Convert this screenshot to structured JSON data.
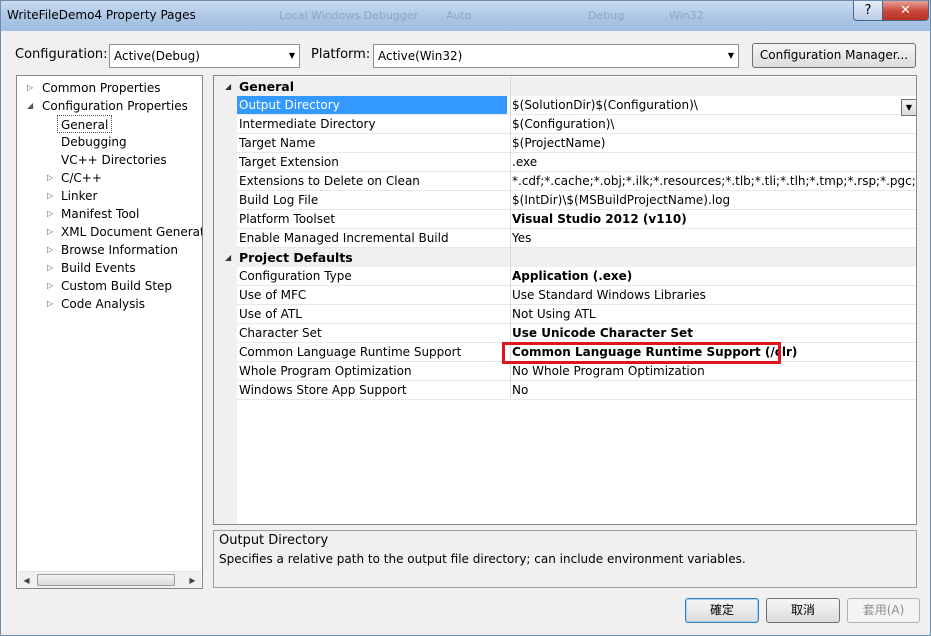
{
  "window": {
    "title": "WriteFileDemo4 Property Pages",
    "background_title_text": [
      "Local Windows Debugger",
      "Auto",
      "Debug",
      "Win32"
    ],
    "help_button": "?",
    "close_button": "✕"
  },
  "toolbar": {
    "configuration_label": "Configuration:",
    "configuration_value": "Active(Debug)",
    "platform_label": "Platform:",
    "platform_value": "Active(Win32)",
    "config_manager_button": "Configuration Manager..."
  },
  "tree": {
    "items": [
      {
        "label": "Common Properties",
        "expander": "▷"
      },
      {
        "label": "Configuration Properties",
        "expander": "◢"
      },
      {
        "label": "General",
        "expander": "",
        "selected": true
      },
      {
        "label": "Debugging",
        "expander": ""
      },
      {
        "label": "VC++ Directories",
        "expander": ""
      },
      {
        "label": "C/C++",
        "expander": "▷"
      },
      {
        "label": "Linker",
        "expander": "▷"
      },
      {
        "label": "Manifest Tool",
        "expander": "▷"
      },
      {
        "label": "XML Document Generator",
        "expander": "▷"
      },
      {
        "label": "Browse Information",
        "expander": "▷"
      },
      {
        "label": "Build Events",
        "expander": "▷"
      },
      {
        "label": "Custom Build Step",
        "expander": "▷"
      },
      {
        "label": "Code Analysis",
        "expander": "▷"
      }
    ]
  },
  "grid": {
    "categories": [
      {
        "name": "General",
        "expander": "◢",
        "rows": [
          {
            "name": "Output Directory",
            "value": "$(SolutionDir)$(Configuration)\\",
            "bold": false,
            "selected": true
          },
          {
            "name": "Intermediate Directory",
            "value": "$(Configuration)\\",
            "bold": false
          },
          {
            "name": "Target Name",
            "value": "$(ProjectName)",
            "bold": false
          },
          {
            "name": "Target Extension",
            "value": ".exe",
            "bold": false
          },
          {
            "name": "Extensions to Delete on Clean",
            "value": "*.cdf;*.cache;*.obj;*.ilk;*.resources;*.tlb;*.tli;*.tlh;*.tmp;*.rsp;*.pgc;*.pgd;*.meta;*.tlog;*.manifest;*.res",
            "bold": false
          },
          {
            "name": "Build Log File",
            "value": "$(IntDir)\\$(MSBuildProjectName).log",
            "bold": false
          },
          {
            "name": "Platform Toolset",
            "value": "Visual Studio 2012 (v110)",
            "bold": true
          },
          {
            "name": "Enable Managed Incremental Build",
            "value": "Yes",
            "bold": false
          }
        ]
      },
      {
        "name": "Project Defaults",
        "expander": "◢",
        "rows": [
          {
            "name": "Configuration Type",
            "value": "Application (.exe)",
            "bold": true
          },
          {
            "name": "Use of MFC",
            "value": "Use Standard Windows Libraries",
            "bold": false
          },
          {
            "name": "Use of ATL",
            "value": "Not Using ATL",
            "bold": false
          },
          {
            "name": "Character Set",
            "value": "Use Unicode Character Set",
            "bold": true
          },
          {
            "name": "Common Language Runtime Support",
            "value": "Common Language Runtime Support (/clr)",
            "bold": true,
            "highlighted": true
          },
          {
            "name": "Whole Program Optimization",
            "value": "No Whole Program Optimization",
            "bold": false
          },
          {
            "name": "Windows Store App Support",
            "value": "No",
            "bold": false
          }
        ]
      }
    ],
    "highlight_color": "#e0151b",
    "selection_color": "#3399ff"
  },
  "description": {
    "title": "Output Directory",
    "text": "Specifies a relative path to the output file directory; can include environment variables."
  },
  "buttons": {
    "ok": "確定",
    "cancel": "取消",
    "apply": "套用(A)"
  }
}
